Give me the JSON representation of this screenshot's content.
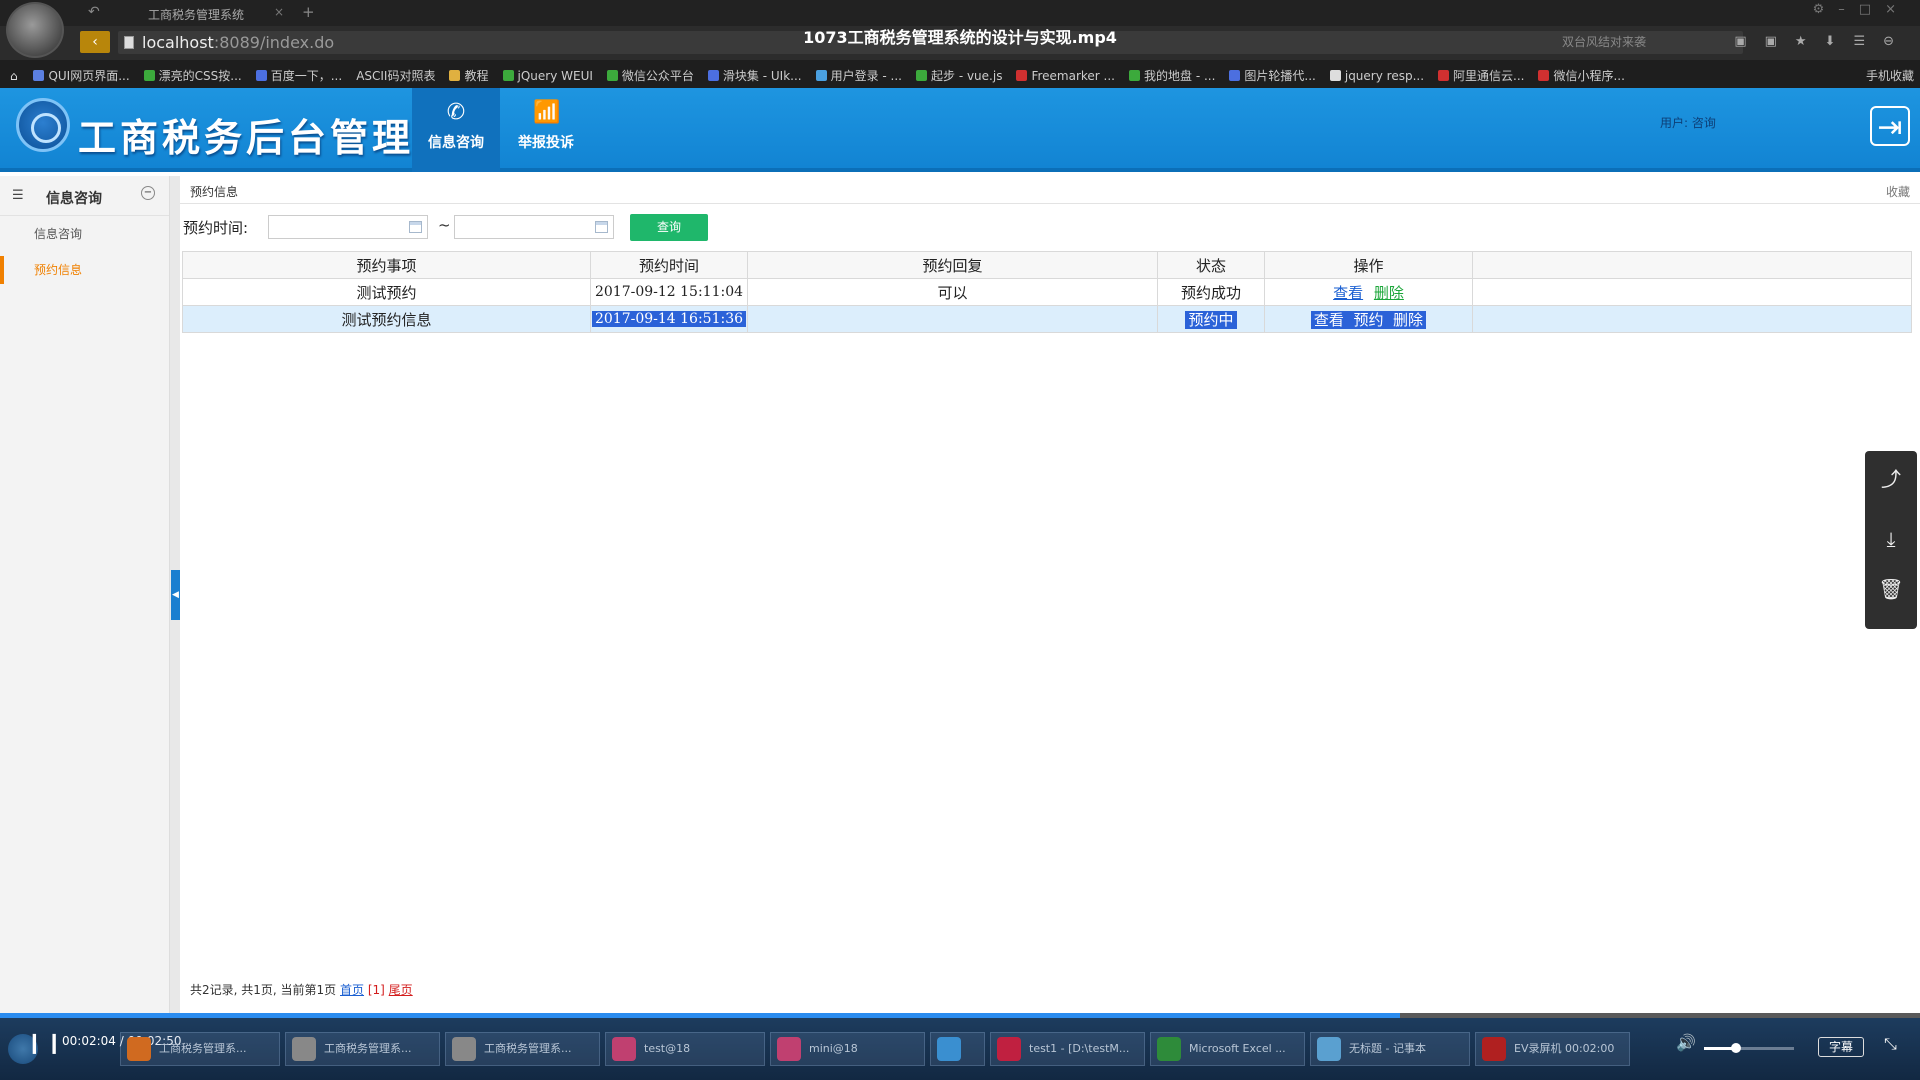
{
  "browser": {
    "tab_title": "工商税务管理系统",
    "video_title": "1073工商税务管理系统的设计与实现.mp4",
    "url_host": "localhost",
    "url_rest": ":8089/index.do",
    "search_placeholder": "双台风结对来袭",
    "bookmarks": [
      {
        "label": "QUI网页界面...",
        "color": "#5b7fe0"
      },
      {
        "label": "漂亮的CSS按...",
        "color": "#3caa3c"
      },
      {
        "label": "百度一下，...",
        "color": "#4c6fe0"
      },
      {
        "label": "ASCII码对照表",
        "color": ""
      },
      {
        "label": "教程",
        "color": "#e0b040"
      },
      {
        "label": "jQuery WEUI",
        "color": "#3caa3c"
      },
      {
        "label": "微信公众平台",
        "color": "#3caa3c"
      },
      {
        "label": "滑块集 - UIk...",
        "color": "#4c6fe0"
      },
      {
        "label": "用户登录 - ...",
        "color": "#4aa0e0"
      },
      {
        "label": "起步 - vue.js",
        "color": "#3caa3c"
      },
      {
        "label": "Freemarker ...",
        "color": "#d03030"
      },
      {
        "label": "我的地盘 - ...",
        "color": "#3caa3c"
      },
      {
        "label": "图片轮播代...",
        "color": "#4c6fe0"
      },
      {
        "label": "jquery resp...",
        "color": "#dddddd"
      },
      {
        "label": "阿里通信云...",
        "color": "#d03030"
      },
      {
        "label": "微信小程序...",
        "color": "#d03030"
      }
    ],
    "mobile_bookmarks": "手机收藏"
  },
  "app": {
    "title": "工商税务后台管理",
    "menu": [
      {
        "label": "信息咨询",
        "icon": "phone-icon"
      },
      {
        "label": "举报投诉",
        "icon": "bar-chart-icon"
      }
    ],
    "user_label": "用户: 咨询"
  },
  "sidebar": {
    "title": "信息咨询",
    "items": [
      {
        "label": "信息咨询",
        "active": false
      },
      {
        "label": "预约信息",
        "active": true
      }
    ]
  },
  "main": {
    "panel_title": "预约信息",
    "panel_fav": "收藏",
    "search_label": "预约时间:",
    "date_separator": "~",
    "date_start_value": "",
    "date_end_value": "",
    "query_button": "查询",
    "columns": [
      "预约事项",
      "预约时间",
      "预约回复",
      "状态",
      "操作"
    ],
    "rows": [
      {
        "item": "测试预约",
        "time": "2017-09-12 15:11:04",
        "reply": "可以",
        "status": "预约成功",
        "ops": [
          "查看",
          "删除"
        ]
      },
      {
        "item": "测试预约信息",
        "time": "2017-09-14 16:51:36",
        "reply": "",
        "status": "预约中",
        "ops": [
          "查看",
          "预约",
          "删除"
        ]
      }
    ],
    "pager": {
      "summary": "共2记录, 共1页, 当前第1页",
      "first": "首页",
      "current": "[1]",
      "last": "尾页"
    }
  },
  "player": {
    "time": "00:02:04 / 00:02:50",
    "progress": 0.729,
    "volume": 0.35,
    "subtitle_button": "字幕",
    "taskbar": [
      {
        "label": "工商税务管理系...",
        "color": "#d06a20"
      },
      {
        "label": "工商税务管理系...",
        "color": "#888888"
      },
      {
        "label": "工商税务管理系...",
        "color": "#888888"
      },
      {
        "label": "test@18",
        "color": "#c04070"
      },
      {
        "label": "mini@18",
        "color": "#c04070"
      },
      {
        "label": "",
        "color": "#3a8fd0"
      },
      {
        "label": "test1 - [D:\\testM...",
        "color": "#c02040"
      },
      {
        "label": "Microsoft Excel ...",
        "color": "#2e8b3a"
      },
      {
        "label": "无标题 - 记事本",
        "color": "#5aa0d0"
      },
      {
        "label": "EV录屏机 00:02:00",
        "color": "#b02020"
      }
    ]
  }
}
